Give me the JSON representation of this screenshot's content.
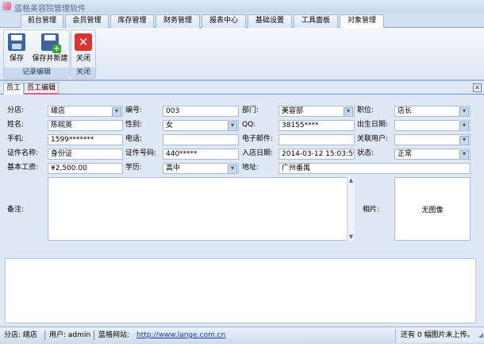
{
  "app": {
    "title": "蓝格美容院管理软件"
  },
  "menu_tabs": [
    "前台管理",
    "会员管理",
    "库存管理",
    "财务管理",
    "报表中心",
    "基础设置",
    "工具面板",
    "对象管理"
  ],
  "ribbon": {
    "save": "保存",
    "save_new": "保存并新建",
    "close": "关闭",
    "group_record": "记录编辑",
    "group_close": "关闭"
  },
  "doc_tabs": [
    "员工",
    "员工编辑"
  ],
  "form": {
    "branch": {
      "label": "分店:",
      "value": "總店"
    },
    "code": {
      "label": "编号:",
      "value": "003"
    },
    "dept": {
      "label": "部门:",
      "value": "美容部"
    },
    "position": {
      "label": "职位:",
      "value": "店长"
    },
    "name": {
      "label": "姓名:",
      "value": "陈皖英"
    },
    "gender": {
      "label": "性别:",
      "value": "女"
    },
    "qq": {
      "label": "QQ:",
      "value": "38155****"
    },
    "birthday": {
      "label": "出生日期:",
      "value": ""
    },
    "mobile": {
      "label": "手机:",
      "value": "1599*******"
    },
    "phone": {
      "label": "电话:",
      "value": ""
    },
    "email": {
      "label": "电子邮件:",
      "value": ""
    },
    "linked_user": {
      "label": "关联用户:",
      "value": ""
    },
    "id_type": {
      "label": "证件名称:",
      "value": "身份证"
    },
    "id_no": {
      "label": "证件号码:",
      "value": "440*****"
    },
    "join_date": {
      "label": "入店日期:",
      "value": "2014-03-12 15:03:59"
    },
    "status": {
      "label": "状态:",
      "value": "正常"
    },
    "salary": {
      "label": "基本工资:",
      "value": "¥2,500.00"
    },
    "education": {
      "label": "学历:",
      "value": "高中"
    },
    "address": {
      "label": "地址:",
      "value": "广州番禺"
    },
    "notes": {
      "label": "备注:",
      "value": ""
    },
    "photo": {
      "label": "相片:",
      "value": "无图像"
    }
  },
  "status": {
    "branch": "分店: 總店",
    "user": "用户: admin",
    "site_label": "蓝格网站:",
    "site_url": "http://www.lange.com.cn",
    "pending": "还有 0 幅图片未上传。"
  }
}
